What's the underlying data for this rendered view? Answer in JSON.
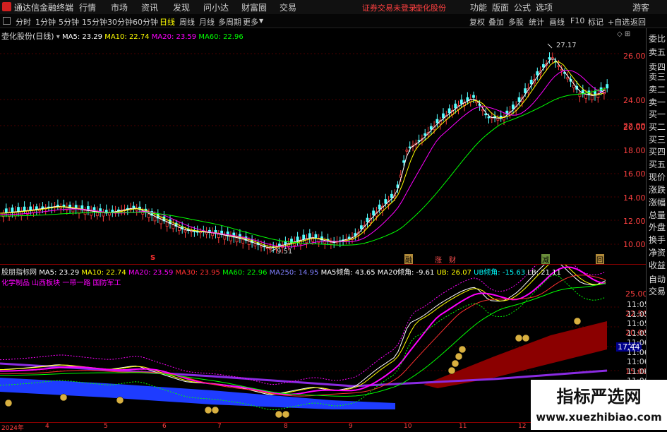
{
  "app": {
    "logo": "通达信金融终端",
    "menus": [
      "行情",
      "市场",
      "资讯",
      "发现",
      "问小达",
      "财富圈",
      "交易"
    ],
    "status": "证券交易未登录",
    "stock": "壶化股份",
    "right_menus": [
      "功能",
      "版面",
      "公式",
      "选项"
    ],
    "guest": "游客"
  },
  "toolbar": {
    "periods": [
      "分时",
      "1分钟",
      "5分钟",
      "15分钟",
      "30分钟",
      "60分钟",
      "日线",
      "周线",
      "月线",
      "多周期",
      "更多"
    ],
    "active": "日线",
    "right": [
      "复权",
      "叠加",
      "多股",
      "统计",
      "画线",
      "F10",
      "标记",
      "+自选",
      "返回"
    ]
  },
  "main_chart": {
    "title": "壶化股份(日线)",
    "legend": [
      {
        "label": "MA5: 23.29",
        "color": "#ffffff"
      },
      {
        "label": "MA10: 22.74",
        "color": "#ffff00"
      },
      {
        "label": "MA20: 23.59",
        "color": "#ff00ff"
      },
      {
        "label": "MA60: 22.96",
        "color": "#00ff00"
      }
    ],
    "y_ticks": [
      "26.00",
      "24.00",
      "22.00",
      "20.00",
      "18.00",
      "16.00",
      "14.00",
      "12.00",
      "10.00"
    ],
    "high_label": "27.17",
    "low_label": "9.51",
    "markers": [
      "S",
      "融",
      "涨",
      "财",
      "减",
      "回"
    ]
  },
  "sub_chart": {
    "title": "股朋指标网",
    "legend": [
      {
        "label": "MA5: 23.29",
        "color": "#ffffff"
      },
      {
        "label": "MA10: 22.74",
        "color": "#ffff00"
      },
      {
        "label": "MA20: 23.59",
        "color": "#ff00ff"
      },
      {
        "label": "MA30: 23.95",
        "color": "#ff3030"
      },
      {
        "label": "MA60: 22.96",
        "color": "#00ff00"
      },
      {
        "label": "MA250: 14.95",
        "color": "#8080ff"
      },
      {
        "label": "MA5倾角: 43.65",
        "color": "#ffffff"
      },
      {
        "label": "MA20倾角: -9.61",
        "color": "#ffffff"
      },
      {
        "label": "UB: 26.07",
        "color": "#ffff00"
      },
      {
        "label": "UB倾角: -15.63",
        "color": "#00ffff"
      },
      {
        "label": "LB: 21.11",
        "color": "#ffffff"
      }
    ],
    "tags": "化学制品 山西板块 一带一路 国防军工",
    "y_ticks": [
      "25.00",
      "22.50",
      "20.00",
      "17.44",
      "15.00"
    ],
    "times": [
      "11:05",
      "11:05",
      "11:05",
      "11:05",
      "11:06",
      "11:06",
      "11:06",
      "11:06",
      "11:06",
      "11:06",
      "11:06",
      "11:06"
    ]
  },
  "x_axis": [
    "2024年",
    "4",
    "5",
    "6",
    "7",
    "8",
    "9",
    "10",
    "11",
    "12"
  ],
  "sidebar": [
    "委比",
    "卖五",
    "卖四",
    "卖三",
    "卖二",
    "卖一",
    "买一",
    "买二",
    "买三",
    "买四",
    "买五",
    "现价",
    "涨跌",
    "涨幅",
    "总量",
    "外盘",
    "换手",
    "净资",
    "收益",
    "自动",
    "交易"
  ],
  "watermark": {
    "title": "指标严选网",
    "url": "www.xuezhibiao.com"
  }
}
